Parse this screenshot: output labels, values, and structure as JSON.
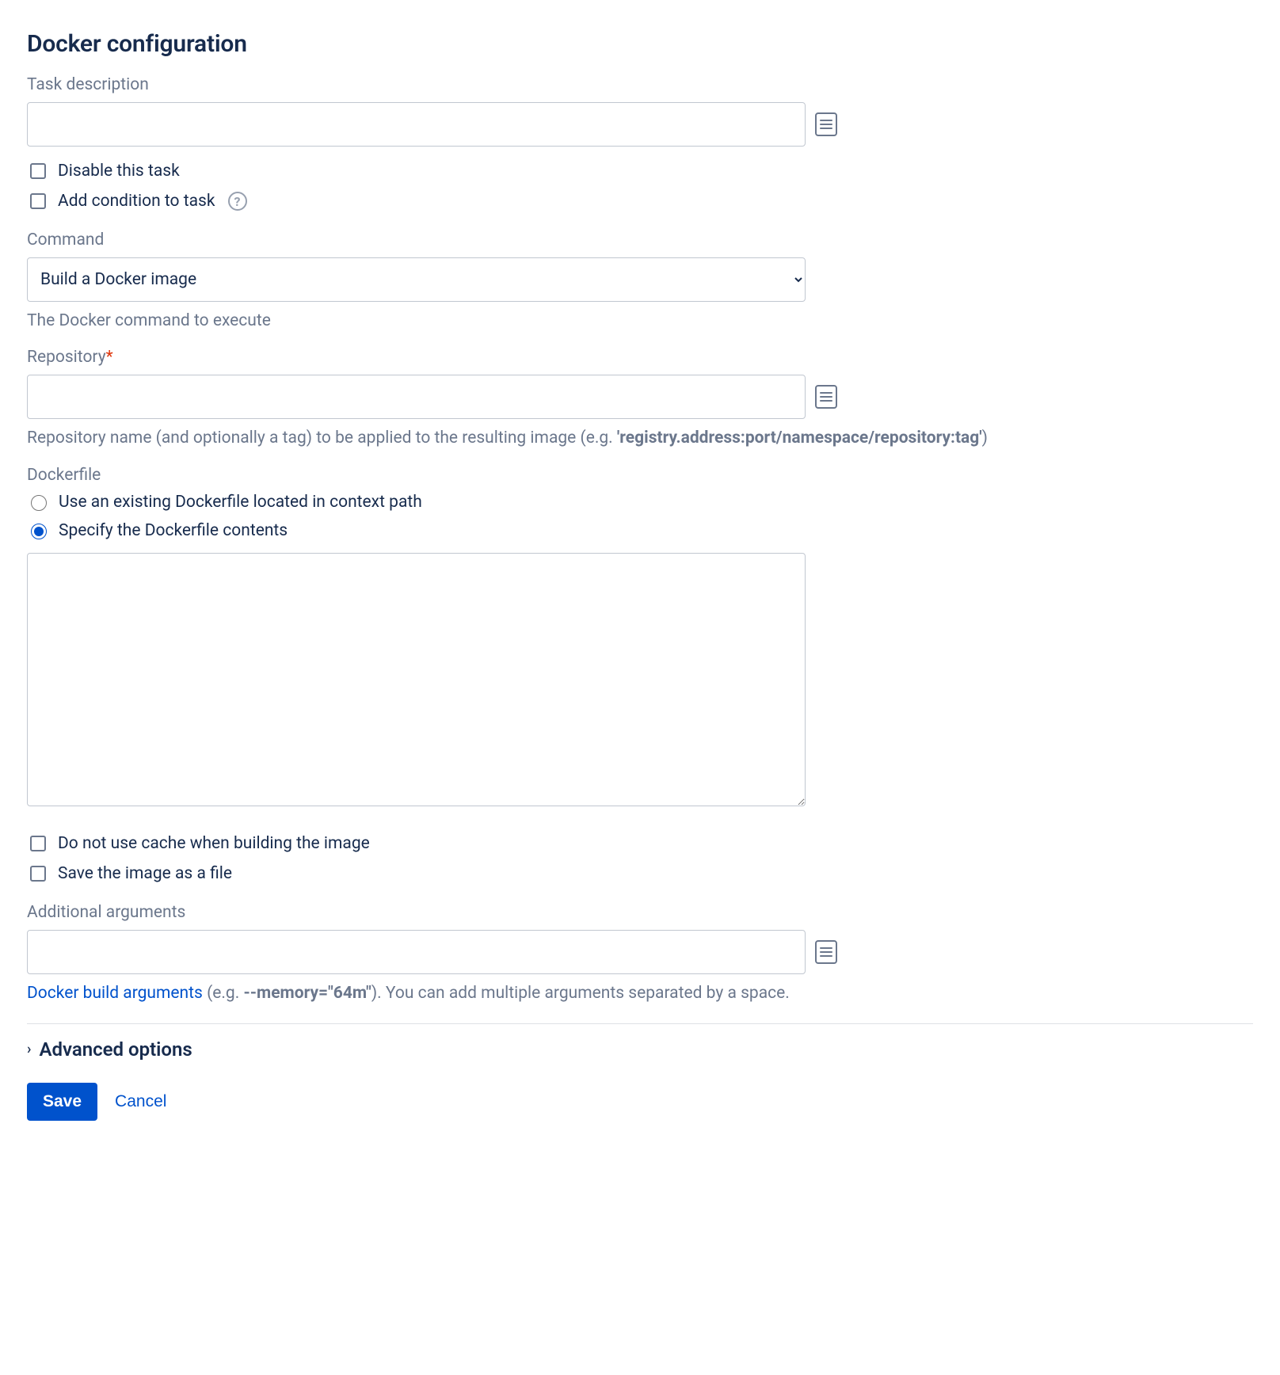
{
  "title": "Docker configuration",
  "task_description": {
    "label": "Task description",
    "value": ""
  },
  "disable_task": {
    "label": "Disable this task"
  },
  "add_condition": {
    "label": "Add condition to task"
  },
  "command": {
    "label": "Command",
    "selected": "Build a Docker image",
    "help": "The Docker command to execute"
  },
  "repository": {
    "label": "Repository",
    "value": "",
    "help_prefix": "Repository name (and optionally a tag) to be applied to the resulting image (e.g. ",
    "help_code": "'registry.address:port/namespace/repository:tag'",
    "help_suffix": ")"
  },
  "dockerfile": {
    "label": "Dockerfile",
    "options": {
      "existing": "Use an existing Dockerfile located in context path",
      "inline": "Specify the Dockerfile contents"
    },
    "contents": ""
  },
  "no_cache": {
    "label": "Do not use cache when building the image"
  },
  "save_as_file": {
    "label": "Save the image as a file"
  },
  "additional_args": {
    "label": "Additional arguments",
    "value": "",
    "help_link": "Docker build arguments",
    "help_eg_prefix": " (e.g. ",
    "help_eg_code": "--memory=\"64m\"",
    "help_suffix": "). You can add multiple arguments separated by a space."
  },
  "advanced": {
    "label": "Advanced options"
  },
  "actions": {
    "save": "Save",
    "cancel": "Cancel"
  }
}
